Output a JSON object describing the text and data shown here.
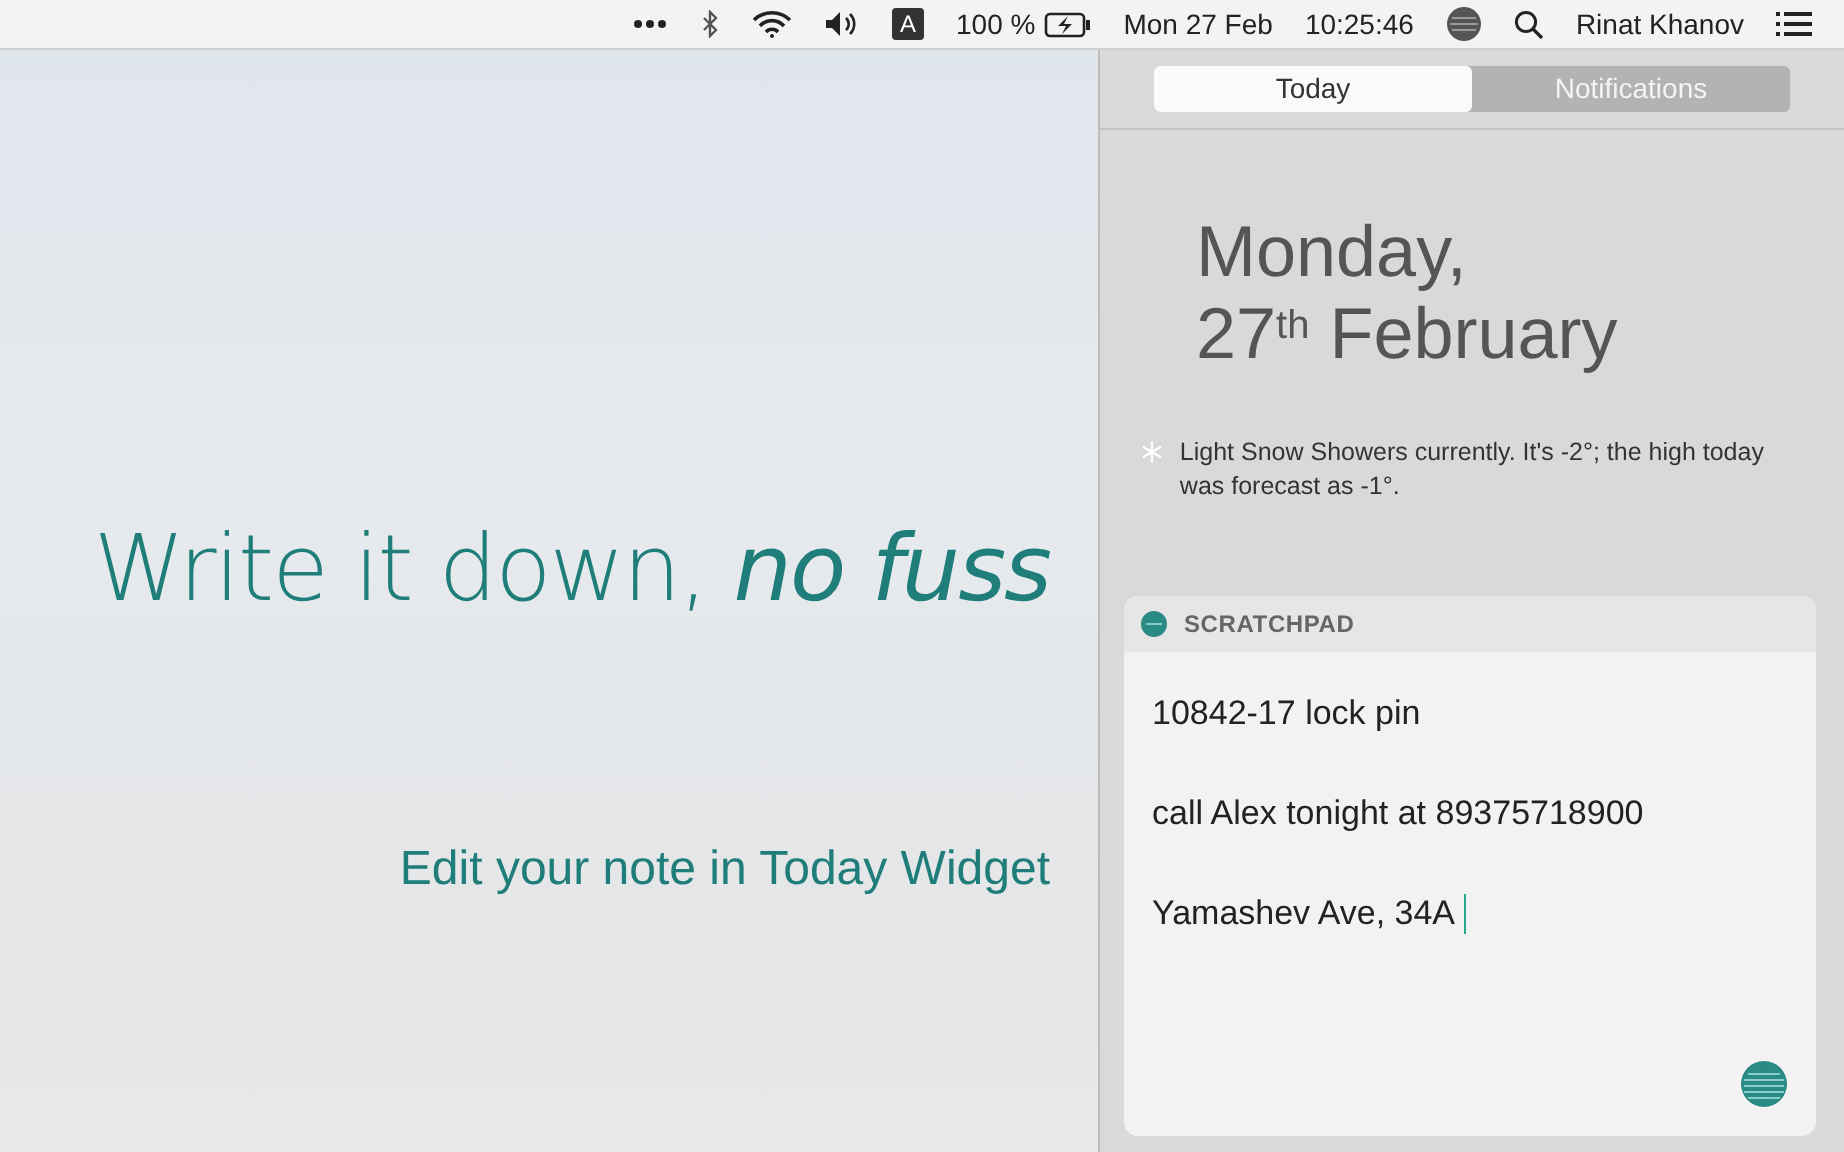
{
  "menu_bar": {
    "input_source": "A",
    "battery": "100 %",
    "date": "Mon 27 Feb",
    "time": "10:25:46",
    "user": "Rinat Khanov"
  },
  "promo": {
    "headline": "Write it down, *no fuss*",
    "subtitle": "Edit your note in Today Widget"
  },
  "tabs": [
    {
      "label": "Today",
      "selected": true
    },
    {
      "label": "Notifications",
      "selected": false
    }
  ],
  "date_lines": [
    "Monday,",
    "27$^{th}$ February"
  ],
  "weather": "Light Snow Showers currently. It's -2°; the high today was forecast as -1°.",
  "widget": {
    "title": "SCRATCHPAD",
    "lines": [
      "10842-17 lock pin",
      "call Alex tonight at 89375718900",
      "Yamashev Ave, 34A"
    ]
  }
}
